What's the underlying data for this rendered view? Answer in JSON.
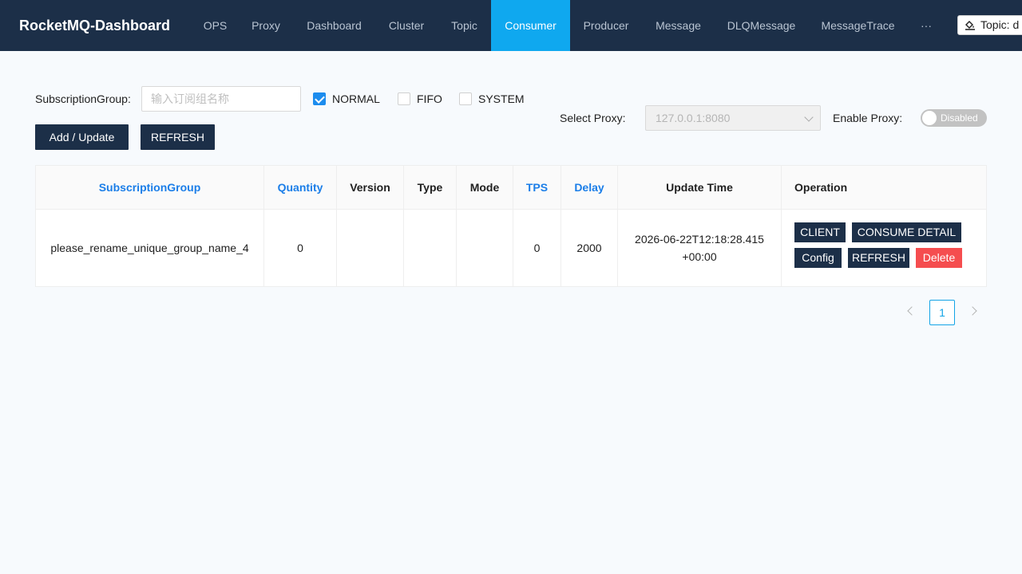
{
  "nav": {
    "brand": "RocketMQ-Dashboard",
    "items": [
      {
        "label": "OPS"
      },
      {
        "label": "Proxy"
      },
      {
        "label": "Dashboard"
      },
      {
        "label": "Cluster"
      },
      {
        "label": "Topic"
      },
      {
        "label": "Consumer"
      },
      {
        "label": "Producer"
      },
      {
        "label": "Message"
      },
      {
        "label": "DLQMessage"
      },
      {
        "label": "MessageTrace"
      },
      {
        "label": "···"
      }
    ],
    "active_item": "Consumer",
    "topic_badge": "Topic: d"
  },
  "filters": {
    "subscription_label": "SubscriptionGroup:",
    "subscription_placeholder": "输入订阅组名称",
    "subscription_value": "",
    "checkboxes": [
      {
        "label": "NORMAL",
        "checked": true
      },
      {
        "label": "FIFO",
        "checked": false
      },
      {
        "label": "SYSTEM",
        "checked": false
      }
    ],
    "add_update_label": "Add / Update",
    "refresh_label": "REFRESH",
    "select_proxy_label": "Select Proxy:",
    "select_proxy_value": "127.0.0.1:8080",
    "enable_proxy_label": "Enable Proxy:",
    "enable_proxy_state": "Disabled"
  },
  "table": {
    "columns": [
      "SubscriptionGroup",
      "Quantity",
      "Version",
      "Type",
      "Mode",
      "TPS",
      "Delay",
      "Update Time",
      "Operation"
    ],
    "rows": [
      {
        "group": "please_rename_unique_group_name_4",
        "quantity": "0",
        "version": "",
        "type": "",
        "mode": "",
        "tps": "0",
        "delay": "2000",
        "update_time": "2026-06-22T12:18:28.415+00:00",
        "actions": {
          "client": "CLIENT",
          "consume_detail": "CONSUME DETAIL",
          "config": "Config",
          "refresh": "REFRESH",
          "delete": "Delete"
        }
      }
    ]
  },
  "pagination": {
    "current_page": "1"
  },
  "colors": {
    "nav_bg": "#1c2f48",
    "nav_active": "#0fa8ef",
    "link_blue": "#1b7ee8",
    "danger": "#f54d4f"
  }
}
